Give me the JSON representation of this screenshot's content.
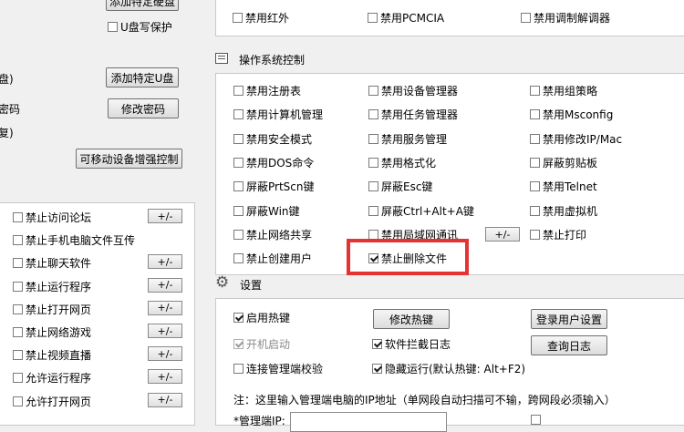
{
  "left_top": {
    "add_disk_btn_partial": "添加特定硬盘",
    "usb_write_protect": "U盘写保护",
    "row_label_1": "盘)",
    "add_usb_btn": "添加特定U盘",
    "row_label_2": "密码",
    "modify_pwd_btn": "修改密码",
    "row_label_3": "复)",
    "removable_btn": "可移动设备增强控制"
  },
  "left_list": [
    {
      "label": "禁止访问论坛",
      "btn": "+/-"
    },
    {
      "label": "禁止手机电脑文件互传",
      "btn": ""
    },
    {
      "label": "禁止聊天软件",
      "btn": "+/-"
    },
    {
      "label": "禁止运行程序",
      "btn": "+/-"
    },
    {
      "label": "禁止打开网页",
      "btn": "+/-"
    },
    {
      "label": "禁止网络游戏",
      "btn": "+/-"
    },
    {
      "label": "禁止视频直播",
      "btn": "+/-"
    },
    {
      "label": "允许运行程序",
      "btn": "+/-"
    },
    {
      "label": "允许打开网页",
      "btn": "+/-"
    }
  ],
  "top_row": [
    "禁用红外",
    "禁用PCMCIA",
    "禁用调制解调器"
  ],
  "os_section": {
    "title": "操作系统控制",
    "col1": [
      "禁用注册表",
      "禁用计算机管理",
      "禁用安全模式",
      "禁用DOS命令",
      "屏蔽PrtScn键",
      "屏蔽Win键",
      "禁止网络共享",
      "禁止创建用户"
    ],
    "col2": [
      "禁用设备管理器",
      "禁用任务管理器",
      "禁用服务管理",
      "禁用格式化",
      "屏蔽Esc键",
      "屏蔽Ctrl+Alt+A键",
      "禁用局域网通讯",
      "禁止删除文件"
    ],
    "col3": [
      "禁用组策略",
      "禁用Msconfig",
      "禁用修改IP/Mac",
      "屏蔽剪贴板",
      "禁用Telnet",
      "禁用虚拟机",
      "禁止打印"
    ],
    "lan_btn": "+/-"
  },
  "settings": {
    "title": "设置",
    "enable_hotkey": "启用热键",
    "auto_start": "开机启动",
    "connect_check": "连接管理端校验",
    "modify_hotkey_btn": "修改热键",
    "software_log": "软件拦截日志",
    "hidden_run": "隐藏运行(默认热键: Alt+F2)",
    "login_settings_btn": "登录用户设置",
    "query_log_btn": "查询日志",
    "note": "注：这里输入管理端电脑的IP地址（单网段自动扫描可不输，跨网段必须输入）",
    "mgmt_ip_partial": "*管理端IP:"
  },
  "colors": {
    "highlight": "#e53232",
    "panel_bg": "#ffffff",
    "window_bg": "#f0f0f0"
  }
}
